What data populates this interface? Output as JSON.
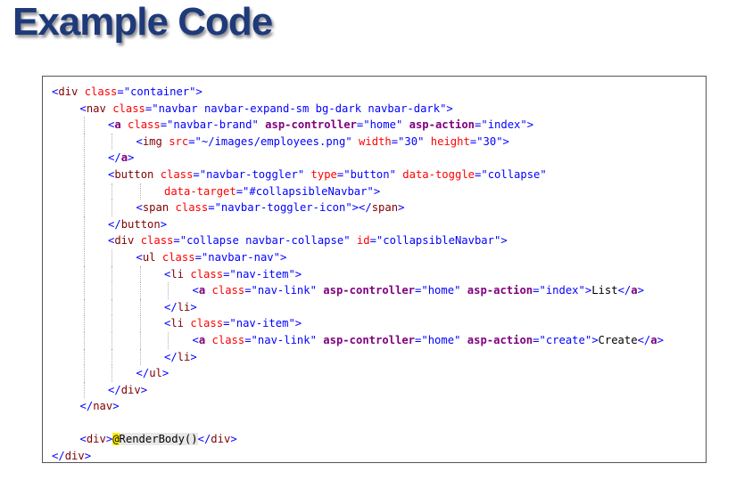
{
  "title": "Example Code",
  "colors": {
    "title": "#1f3a7a",
    "delimiter": "#0000ff",
    "tag": "#800000",
    "attribute": "#ff0000",
    "value": "#0000ff",
    "tag_helper": "#800080",
    "text": "#000000",
    "razor_highlight": "#ffee00"
  },
  "code_lines": [
    {
      "indent": 0,
      "tokens": [
        [
          "d",
          "<"
        ],
        [
          "t",
          "div"
        ],
        [
          "x",
          " "
        ],
        [
          "a",
          "class"
        ],
        [
          "d",
          "=\""
        ],
        [
          "s",
          "container"
        ],
        [
          "d",
          "\">"
        ]
      ]
    },
    {
      "indent": 1,
      "tokens": [
        [
          "d",
          "<"
        ],
        [
          "t",
          "nav"
        ],
        [
          "x",
          " "
        ],
        [
          "a",
          "class"
        ],
        [
          "d",
          "=\""
        ],
        [
          "s",
          "navbar navbar-expand-sm bg-dark navbar-dark"
        ],
        [
          "d",
          "\">"
        ]
      ]
    },
    {
      "indent": 2,
      "tokens": [
        [
          "d",
          "<"
        ],
        [
          "b",
          "a"
        ],
        [
          "x",
          " "
        ],
        [
          "a",
          "class"
        ],
        [
          "d",
          "=\""
        ],
        [
          "s",
          "navbar-brand"
        ],
        [
          "d",
          "\""
        ],
        [
          "x",
          " "
        ],
        [
          "b",
          "asp-controller"
        ],
        [
          "d",
          "=\""
        ],
        [
          "s",
          "home"
        ],
        [
          "d",
          "\""
        ],
        [
          "x",
          " "
        ],
        [
          "b",
          "asp-action"
        ],
        [
          "d",
          "=\""
        ],
        [
          "s",
          "index"
        ],
        [
          "d",
          "\">"
        ]
      ]
    },
    {
      "indent": 3,
      "tokens": [
        [
          "d",
          "<"
        ],
        [
          "t",
          "img"
        ],
        [
          "x",
          " "
        ],
        [
          "a",
          "src"
        ],
        [
          "d",
          "=\""
        ],
        [
          "s",
          "~/images/employees.png"
        ],
        [
          "d",
          "\""
        ],
        [
          "x",
          " "
        ],
        [
          "a",
          "width"
        ],
        [
          "d",
          "=\""
        ],
        [
          "s",
          "30"
        ],
        [
          "d",
          "\""
        ],
        [
          "x",
          " "
        ],
        [
          "a",
          "height"
        ],
        [
          "d",
          "=\""
        ],
        [
          "s",
          "30"
        ],
        [
          "d",
          "\">"
        ]
      ]
    },
    {
      "indent": 2,
      "tokens": [
        [
          "d",
          "</"
        ],
        [
          "b",
          "a"
        ],
        [
          "d",
          ">"
        ]
      ]
    },
    {
      "indent": 2,
      "tokens": [
        [
          "d",
          "<"
        ],
        [
          "t",
          "button"
        ],
        [
          "x",
          " "
        ],
        [
          "a",
          "class"
        ],
        [
          "d",
          "=\""
        ],
        [
          "s",
          "navbar-toggler"
        ],
        [
          "d",
          "\""
        ],
        [
          "x",
          " "
        ],
        [
          "a",
          "type"
        ],
        [
          "d",
          "=\""
        ],
        [
          "s",
          "button"
        ],
        [
          "d",
          "\""
        ],
        [
          "x",
          " "
        ],
        [
          "a",
          "data-toggle"
        ],
        [
          "d",
          "=\""
        ],
        [
          "s",
          "collapse"
        ],
        [
          "d",
          "\""
        ]
      ]
    },
    {
      "indent": 4,
      "tokens": [
        [
          "a",
          "data-target"
        ],
        [
          "d",
          "=\""
        ],
        [
          "s",
          "#collapsibleNavbar"
        ],
        [
          "d",
          "\">"
        ]
      ]
    },
    {
      "indent": 3,
      "tokens": [
        [
          "d",
          "<"
        ],
        [
          "t",
          "span"
        ],
        [
          "x",
          " "
        ],
        [
          "a",
          "class"
        ],
        [
          "d",
          "=\""
        ],
        [
          "s",
          "navbar-toggler-icon"
        ],
        [
          "d",
          "\"></"
        ],
        [
          "t",
          "span"
        ],
        [
          "d",
          ">"
        ]
      ]
    },
    {
      "indent": 2,
      "tokens": [
        [
          "d",
          "</"
        ],
        [
          "t",
          "button"
        ],
        [
          "d",
          ">"
        ]
      ]
    },
    {
      "indent": 2,
      "tokens": [
        [
          "d",
          "<"
        ],
        [
          "t",
          "div"
        ],
        [
          "x",
          " "
        ],
        [
          "a",
          "class"
        ],
        [
          "d",
          "=\""
        ],
        [
          "s",
          "collapse navbar-collapse"
        ],
        [
          "d",
          "\""
        ],
        [
          "x",
          " "
        ],
        [
          "a",
          "id"
        ],
        [
          "d",
          "=\""
        ],
        [
          "s",
          "collapsibleNavbar"
        ],
        [
          "d",
          "\">"
        ]
      ]
    },
    {
      "indent": 3,
      "tokens": [
        [
          "d",
          "<"
        ],
        [
          "t",
          "ul"
        ],
        [
          "x",
          " "
        ],
        [
          "a",
          "class"
        ],
        [
          "d",
          "=\""
        ],
        [
          "s",
          "navbar-nav"
        ],
        [
          "d",
          "\">"
        ]
      ]
    },
    {
      "indent": 4,
      "tokens": [
        [
          "d",
          "<"
        ],
        [
          "t",
          "li"
        ],
        [
          "x",
          " "
        ],
        [
          "a",
          "class"
        ],
        [
          "d",
          "=\""
        ],
        [
          "s",
          "nav-item"
        ],
        [
          "d",
          "\">"
        ]
      ]
    },
    {
      "indent": 5,
      "tokens": [
        [
          "d",
          "<"
        ],
        [
          "b",
          "a"
        ],
        [
          "x",
          " "
        ],
        [
          "a",
          "class"
        ],
        [
          "d",
          "=\""
        ],
        [
          "s",
          "nav-link"
        ],
        [
          "d",
          "\""
        ],
        [
          "x",
          " "
        ],
        [
          "b",
          "asp-controller"
        ],
        [
          "d",
          "=\""
        ],
        [
          "s",
          "home"
        ],
        [
          "d",
          "\""
        ],
        [
          "x",
          " "
        ],
        [
          "b",
          "asp-action"
        ],
        [
          "d",
          "=\""
        ],
        [
          "s",
          "index"
        ],
        [
          "d",
          "\">"
        ],
        [
          "x",
          "List"
        ],
        [
          "d",
          "</"
        ],
        [
          "b",
          "a"
        ],
        [
          "d",
          ">"
        ]
      ]
    },
    {
      "indent": 4,
      "tokens": [
        [
          "d",
          "</"
        ],
        [
          "t",
          "li"
        ],
        [
          "d",
          ">"
        ]
      ]
    },
    {
      "indent": 4,
      "tokens": [
        [
          "d",
          "<"
        ],
        [
          "t",
          "li"
        ],
        [
          "x",
          " "
        ],
        [
          "a",
          "class"
        ],
        [
          "d",
          "=\""
        ],
        [
          "s",
          "nav-item"
        ],
        [
          "d",
          "\">"
        ]
      ]
    },
    {
      "indent": 5,
      "tokens": [
        [
          "d",
          "<"
        ],
        [
          "b",
          "a"
        ],
        [
          "x",
          " "
        ],
        [
          "a",
          "class"
        ],
        [
          "d",
          "=\""
        ],
        [
          "s",
          "nav-link"
        ],
        [
          "d",
          "\""
        ],
        [
          "x",
          " "
        ],
        [
          "b",
          "asp-controller"
        ],
        [
          "d",
          "=\""
        ],
        [
          "s",
          "home"
        ],
        [
          "d",
          "\""
        ],
        [
          "x",
          " "
        ],
        [
          "b",
          "asp-action"
        ],
        [
          "d",
          "=\""
        ],
        [
          "s",
          "create"
        ],
        [
          "d",
          "\">"
        ],
        [
          "x",
          "Create"
        ],
        [
          "d",
          "</"
        ],
        [
          "b",
          "a"
        ],
        [
          "d",
          ">"
        ]
      ]
    },
    {
      "indent": 4,
      "tokens": [
        [
          "d",
          "</"
        ],
        [
          "t",
          "li"
        ],
        [
          "d",
          ">"
        ]
      ]
    },
    {
      "indent": 3,
      "tokens": [
        [
          "d",
          "</"
        ],
        [
          "t",
          "ul"
        ],
        [
          "d",
          ">"
        ]
      ]
    },
    {
      "indent": 2,
      "tokens": [
        [
          "d",
          "</"
        ],
        [
          "t",
          "div"
        ],
        [
          "d",
          ">"
        ]
      ]
    },
    {
      "indent": 1,
      "tokens": [
        [
          "d",
          "</"
        ],
        [
          "t",
          "nav"
        ],
        [
          "d",
          ">"
        ]
      ]
    },
    {
      "indent": 0,
      "tokens": []
    },
    {
      "indent": 1,
      "tokens": [
        [
          "d",
          "<"
        ],
        [
          "t",
          "div"
        ],
        [
          "d",
          ">"
        ],
        [
          "at",
          "@"
        ],
        [
          "rc",
          "RenderBody()"
        ],
        [
          "d",
          "</"
        ],
        [
          "t",
          "div"
        ],
        [
          "d",
          ">"
        ]
      ]
    },
    {
      "indent": 0,
      "tokens": [
        [
          "d",
          "</"
        ],
        [
          "t",
          "div"
        ],
        [
          "d",
          ">"
        ]
      ]
    }
  ]
}
